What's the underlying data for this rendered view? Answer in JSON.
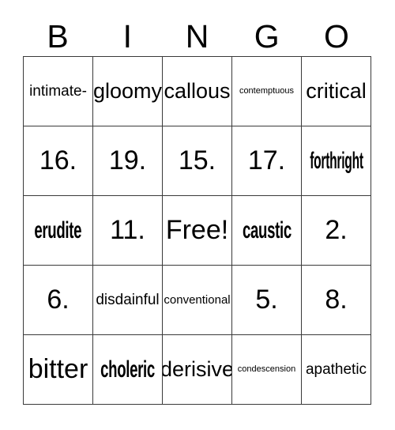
{
  "card": {
    "title": "BINGO",
    "header": [
      "B",
      "I",
      "N",
      "G",
      "O"
    ],
    "free_space_label": "Free!",
    "colors": {
      "background": "#ffffff",
      "text": "#000000",
      "grid_line": "#3a3a3a"
    },
    "rows": [
      [
        {
          "text": "intimate-",
          "style": "sz-md"
        },
        {
          "text": "gloomy",
          "style": "sz-lg"
        },
        {
          "text": "callous",
          "style": "sz-lg"
        },
        {
          "text": "contemptuous",
          "style": "sz-xs"
        },
        {
          "text": "critical",
          "style": "sz-lg"
        }
      ],
      [
        {
          "text": "16.",
          "style": "sz-xl"
        },
        {
          "text": "19.",
          "style": "sz-xl"
        },
        {
          "text": "15.",
          "style": "sz-xl"
        },
        {
          "text": "17.",
          "style": "sz-xl"
        },
        {
          "text": "forthright",
          "style": "squeeze"
        }
      ],
      [
        {
          "text": "erudite",
          "style": "squeeze-wide"
        },
        {
          "text": "11.",
          "style": "sz-xl"
        },
        {
          "text": "Free!",
          "style": "sz-xl"
        },
        {
          "text": "caustic",
          "style": "squeeze-wide"
        },
        {
          "text": "2.",
          "style": "sz-xl"
        }
      ],
      [
        {
          "text": "6.",
          "style": "sz-xl"
        },
        {
          "text": "disdainful",
          "style": "sz-md"
        },
        {
          "text": "conventional",
          "style": "sz-sm"
        },
        {
          "text": "5.",
          "style": "sz-xl"
        },
        {
          "text": "8.",
          "style": "sz-xl"
        }
      ],
      [
        {
          "text": "bitter",
          "style": "sz-xl"
        },
        {
          "text": "choleric",
          "style": "squeeze-wide"
        },
        {
          "text": "derisive",
          "style": "sz-lg"
        },
        {
          "text": "condescension",
          "style": "sz-xs"
        },
        {
          "text": "apathetic",
          "style": "sz-md"
        }
      ]
    ]
  }
}
